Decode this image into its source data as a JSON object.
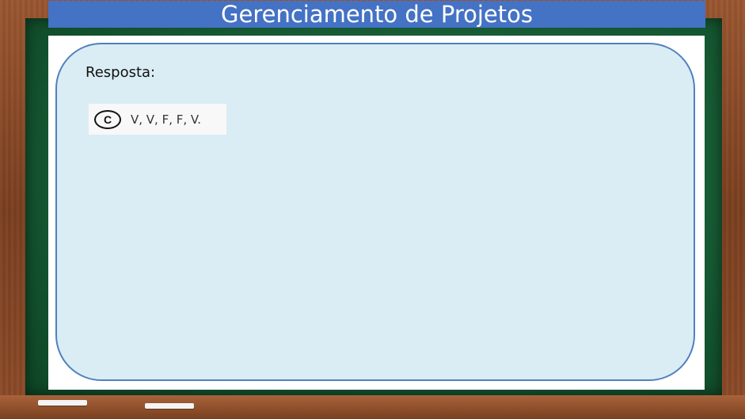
{
  "header": {
    "title": "Gerenciamento de Projetos"
  },
  "answer": {
    "label": "Resposta:",
    "choice_letter": "C",
    "choice_text": "V, V, F, F, V."
  },
  "colors": {
    "title_bar": "#4472c4",
    "answer_box_fill": "#daedf4",
    "answer_box_border": "#4f81bd",
    "board": "#165a33",
    "frame_wood": "#8c4b28"
  }
}
